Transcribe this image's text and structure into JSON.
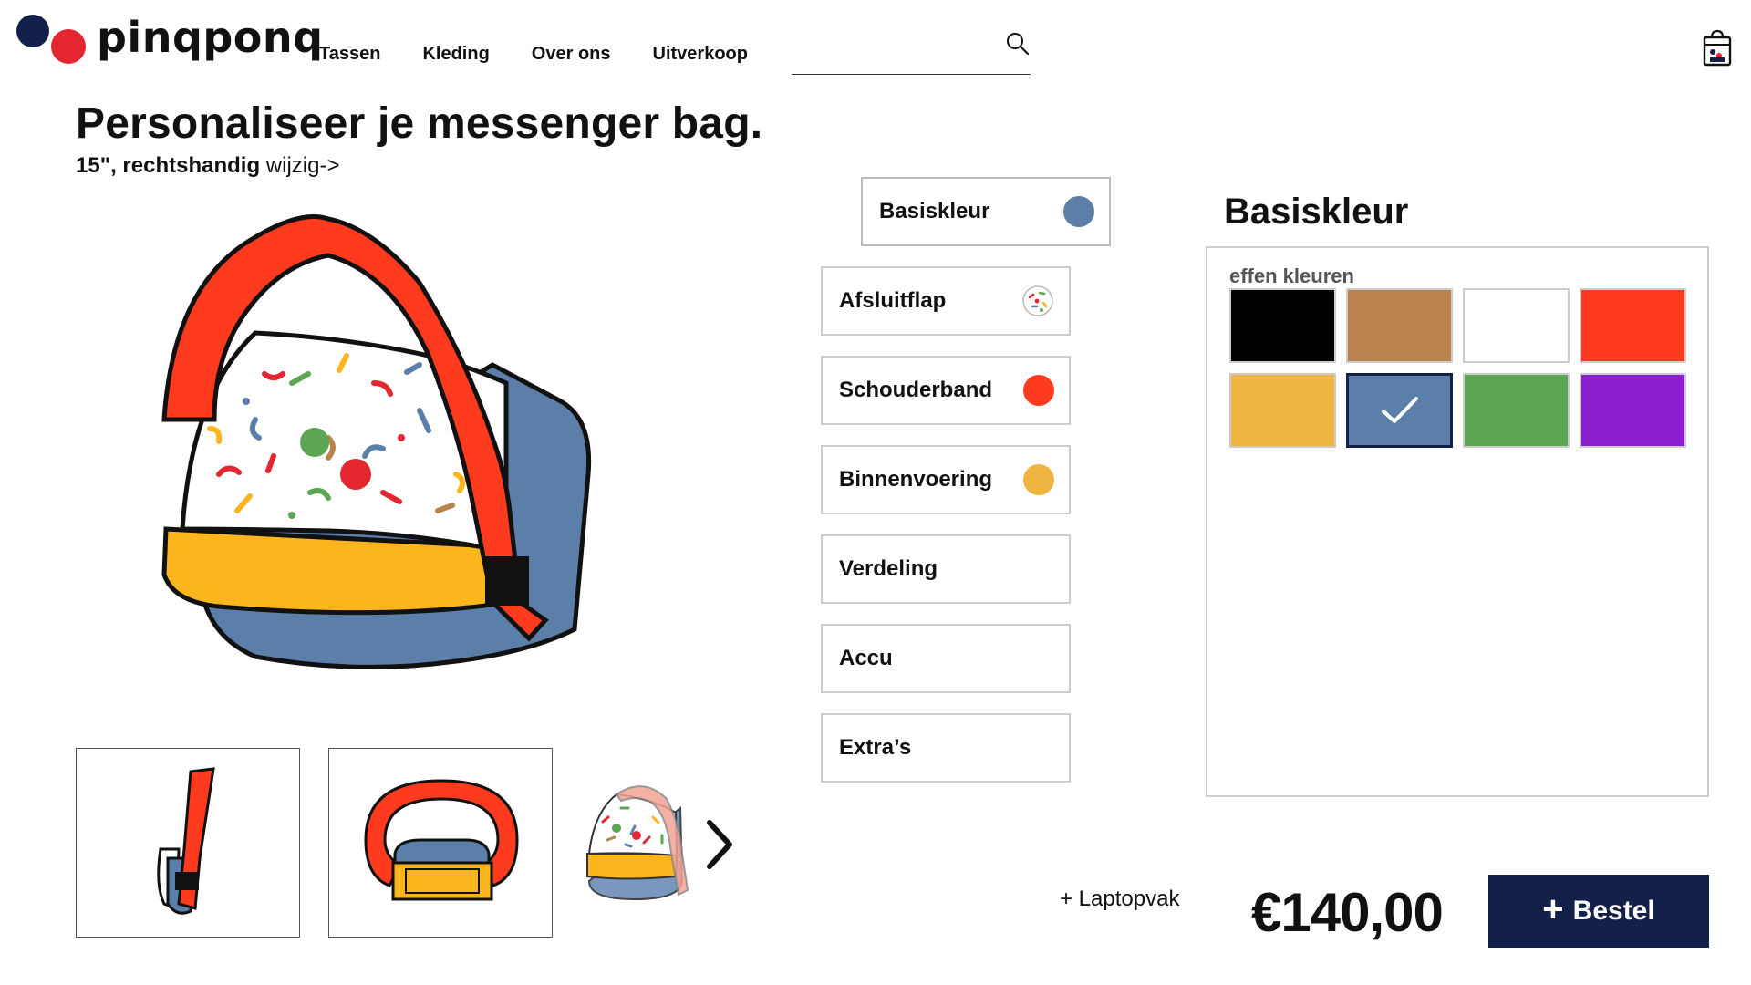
{
  "brand": {
    "name": "pinqponq",
    "navy": "#13204a",
    "red": "#e3262f"
  },
  "nav": {
    "items": [
      "Tassen",
      "Kleding",
      "Over ons",
      "Uitverkoop"
    ]
  },
  "search": {
    "value": "",
    "placeholder": ""
  },
  "page": {
    "title": "Personaliseer je messenger bag.",
    "subtitle_bold": "15\", rechtshandig",
    "subtitle_link": "wijzig->"
  },
  "options": [
    {
      "label": "Basiskleur",
      "color": "#5b7fa8",
      "active": true
    },
    {
      "label": "Afsluitflap",
      "icon": "confetti-pattern-icon"
    },
    {
      "label": "Schouderband",
      "color": "#ff3b1f"
    },
    {
      "label": "Binnenvoering",
      "color": "#f0b440"
    },
    {
      "label": "Verdeling"
    },
    {
      "label": "Accu"
    },
    {
      "label": "Extra’s"
    }
  ],
  "panel": {
    "title": "Basiskleur",
    "subtitle": "effen kleuren",
    "swatches": [
      {
        "name": "black",
        "color": "#000000"
      },
      {
        "name": "brown",
        "color": "#b8834c"
      },
      {
        "name": "white",
        "color": "#ffffff"
      },
      {
        "name": "red",
        "color": "#ff3b1f"
      },
      {
        "name": "yellow",
        "color": "#f0b440"
      },
      {
        "name": "blue",
        "color": "#5b7fa8",
        "selected": true
      },
      {
        "name": "green",
        "color": "#5ba553"
      },
      {
        "name": "purple",
        "color": "#8e1fd0"
      }
    ]
  },
  "footer": {
    "addon": "+ Laptopvak",
    "price": "€140,00",
    "order_label": "Bestel",
    "order_plus": "+"
  }
}
